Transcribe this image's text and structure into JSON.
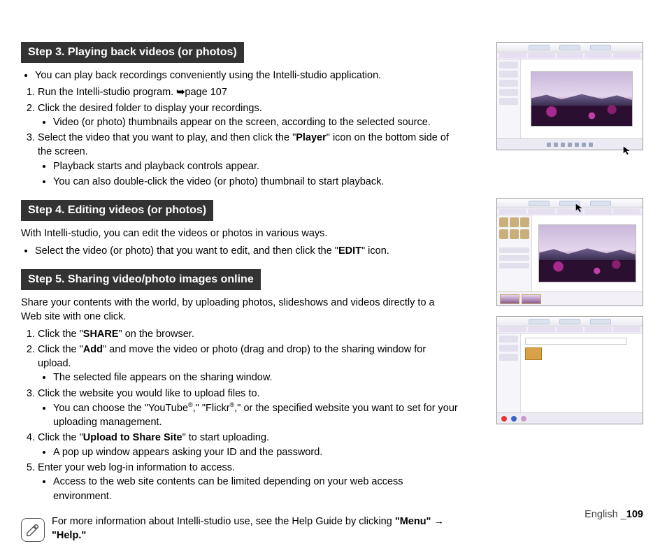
{
  "step3": {
    "title": "Step 3. Playing back videos (or photos)",
    "intro": "You can play back recordings conveniently using the Intelli-studio application.",
    "li1_a": "Run the Intelli-studio program. ",
    "li1_b": "page 107",
    "li2": "Click the desired folder to display your recordings.",
    "li2_sub": "Video (or photo) thumbnails appear on the screen, according to the selected source.",
    "li3_a": "Select the video that you want to play, and then click the \"",
    "li3_b": "Player",
    "li3_c": "\" icon on the bottom side of the screen.",
    "li3_sub1": "Playback starts and playback controls appear.",
    "li3_sub2": "You can also double-click the video (or photo) thumbnail to start playback."
  },
  "step4": {
    "title": "Step 4. Editing videos (or photos)",
    "p1": "With Intelli-studio, you can edit the videos or photos in various ways.",
    "li1_a": "Select the video (or photo) that you want to edit, and then click the \"",
    "li1_b": "EDIT",
    "li1_c": "\" icon."
  },
  "step5": {
    "title": "Step 5. Sharing video/photo images online",
    "p1": "Share your contents with the world, by uploading photos, slideshows and videos directly to a Web site with one click.",
    "li1_a": "Click the \"",
    "li1_b": "SHARE",
    "li1_c": "\" on the browser.",
    "li2_a": "Click the \"",
    "li2_b": "Add",
    "li2_c": "\" and move the video or photo (drag and drop) to the sharing window for upload.",
    "li2_sub": "The selected file appears on the sharing window.",
    "li3": "Click the website you would like to upload files to.",
    "li3_sub_a": "You can choose the \"YouTube",
    "li3_sub_b": ",\" \"Flickr",
    "li3_sub_c": ",\" or the specified website you want to set for your uploading management.",
    "li4_a": "Click the \"",
    "li4_b": "Upload to Share Site",
    "li4_c": "\" to start uploading.",
    "li4_sub": "A pop up window appears asking your ID and the password.",
    "li5": "Enter your web log-in information to access.",
    "li5_sub": "Access to the web site contents can be limited depending on your web access environment."
  },
  "note": {
    "a": "For more information about Intelli-studio use, see the Help Guide by clicking ",
    "b": "\"Menu\"",
    "c": " → ",
    "d": "\"Help.\""
  },
  "footer": {
    "lang": "English _",
    "page": "109"
  },
  "glyph": {
    "arrow": "➥",
    "reg": "®"
  }
}
